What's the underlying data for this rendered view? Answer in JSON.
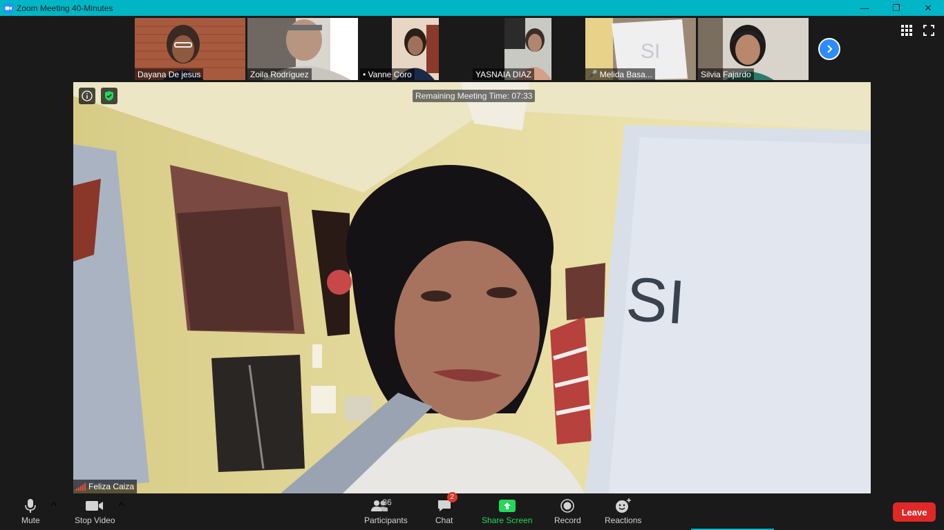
{
  "window": {
    "title": "Zoom Meeting 40-Minutes",
    "controls": [
      "—",
      "❐",
      "✕"
    ]
  },
  "gallery": {
    "participants": [
      {
        "name": "Dayana De jesus",
        "muted": false
      },
      {
        "name": "Zoila Rodríguez",
        "muted": false
      },
      {
        "name": "• Vanne Coro",
        "muted": false
      },
      {
        "name": "YASNAIA DIAZ",
        "muted": false
      },
      {
        "name": "Melida Basa...",
        "muted": true
      },
      {
        "name": "Silvia Fajardo",
        "muted": false
      }
    ]
  },
  "active_speaker": {
    "name": "Feliza Caiza",
    "remaining_time_label": "Remaining Meeting Time: 07:33",
    "card_text": "SI"
  },
  "toolbar": {
    "mute": "Mute",
    "stop_video": "Stop Video",
    "participants": "Participants",
    "participants_count": "36",
    "chat": "Chat",
    "chat_badge": "2",
    "share_screen": "Share Screen",
    "record": "Record",
    "reactions": "Reactions",
    "leave": "Leave"
  },
  "colors": {
    "titlebar": "#00b6c6",
    "accent_blue": "#2d8cff",
    "share_green": "#23d959",
    "leave_red": "#e02828"
  }
}
